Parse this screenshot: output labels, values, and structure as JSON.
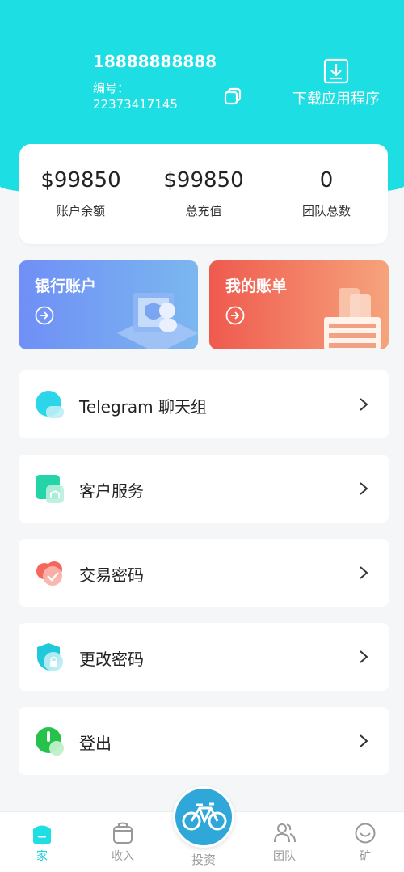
{
  "header": {
    "phone": "18888888888",
    "id_label": "编号：",
    "id_value": "22373417145",
    "download_label": "下载应用程序"
  },
  "stats": [
    {
      "value": "$99850",
      "label": "账户余额"
    },
    {
      "value": "$99850",
      "label": "总充值"
    },
    {
      "value": "0",
      "label": "团队总数"
    }
  ],
  "cards": {
    "bank": {
      "title": "银行账户"
    },
    "bill": {
      "title": "我的账单"
    }
  },
  "menu": [
    {
      "label": "Telegram 聊天组",
      "icon": "telegram-icon"
    },
    {
      "label": "客户服务",
      "icon": "customer-service-icon"
    },
    {
      "label": "交易密码",
      "icon": "transaction-password-icon"
    },
    {
      "label": "更改密码",
      "icon": "change-password-icon"
    },
    {
      "label": "登出",
      "icon": "logout-icon"
    }
  ],
  "tabbar": {
    "home": "家",
    "income": "收入",
    "invest": "投资",
    "team": "团队",
    "mine": "矿"
  },
  "colors": {
    "header": "#1ddfe3",
    "accent": "#1ccfd6",
    "bank_card": "#6f8ff6",
    "bill_card": "#ef5a4e"
  }
}
